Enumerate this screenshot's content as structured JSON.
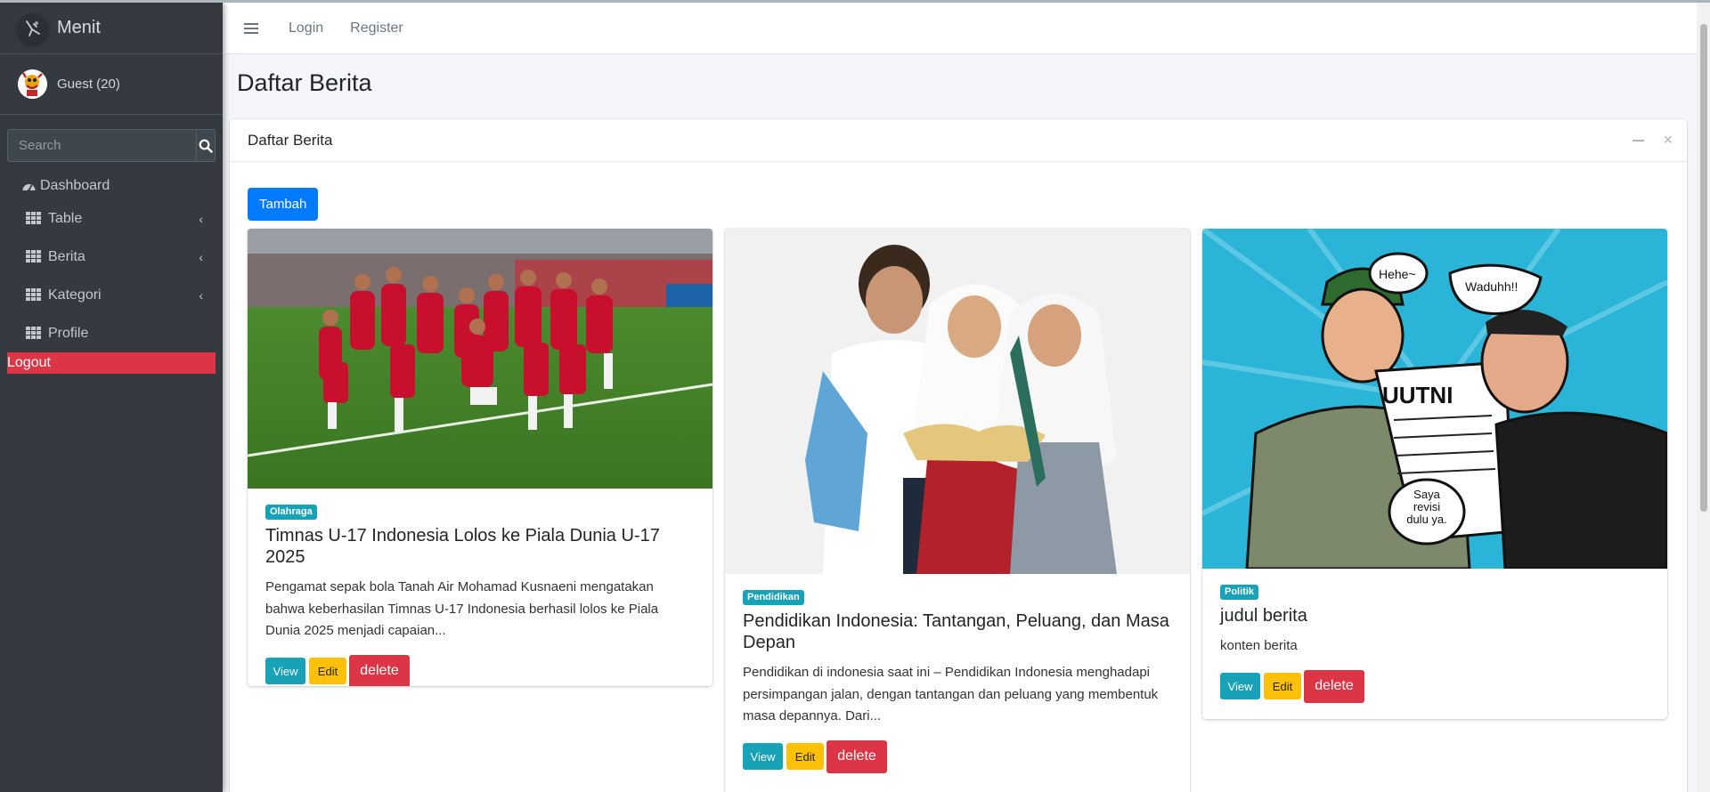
{
  "app": {
    "brand": "Menit"
  },
  "user": {
    "name": "Guest (20)"
  },
  "search": {
    "placeholder": "Search"
  },
  "sidebar": {
    "items": [
      {
        "label": "Dashboard"
      },
      {
        "label": "Table"
      },
      {
        "label": "Berita"
      },
      {
        "label": "Kategori"
      },
      {
        "label": "Profile"
      }
    ],
    "logout": "Logout"
  },
  "navbar": {
    "login": "Login",
    "register": "Register"
  },
  "page": {
    "title": "Daftar Berita"
  },
  "card": {
    "title": "Daftar Berita",
    "add_button": "Tambah"
  },
  "news": [
    {
      "category": "Olahraga",
      "title": "Timnas U-17 Indonesia Lolos ke Piala Dunia U-17 2025",
      "excerpt": "Pengamat sepak bola Tanah Air Mohamad Kusnaeni mengatakan bahwa keberhasilan Timnas U-17 Indonesia berhasil lolos ke Piala Dunia 2025 menjadi capaian...",
      "view": "View",
      "edit": "Edit",
      "delete": "delete"
    },
    {
      "category": "Pendidikan",
      "title": "Pendidikan Indonesia: Tantangan, Peluang, dan Masa Depan",
      "excerpt": "Pendidikan di indonesia saat ini – Pendidikan Indonesia menghadapi persimpangan jalan, dengan tantangan dan peluang yang membentuk masa depannya. Dari...",
      "view": "View",
      "edit": "Edit",
      "delete": "delete"
    },
    {
      "category": "Politik",
      "title": "judul berita",
      "excerpt": "konten berita",
      "view": "View",
      "edit": "Edit",
      "delete": "delete",
      "image_text": {
        "bubble1": "Hehe~",
        "bubble2": "Waduhh!!",
        "paper": "UUTNI",
        "bubble3": "Saya revisi dulu ya."
      }
    }
  ]
}
